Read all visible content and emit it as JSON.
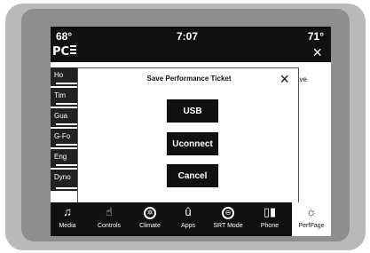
{
  "status": {
    "temp_left": "68°",
    "time": "7:07",
    "temp_right": "71°"
  },
  "app": {
    "logo": "PC",
    "close_icon": "×",
    "menu": [
      "Ho",
      "Tim",
      "Gua",
      "G-Fo",
      "Eng",
      "Dyno"
    ],
    "side_note": "ave"
  },
  "modal": {
    "title": "Save Performance Ticket",
    "close_icon": "×",
    "buttons": {
      "usb": "USB",
      "uconnect": "Uconnect",
      "cancel": "Cancel"
    }
  },
  "dock": {
    "active": "perfpage",
    "items": [
      {
        "label": "Media",
        "icon": "music-note-icon"
      },
      {
        "label": "Controls",
        "icon": "hand-controls-icon"
      },
      {
        "label": "Climate",
        "icon": "fan-icon"
      },
      {
        "label": "Apps",
        "icon": "apps-icon"
      },
      {
        "label": "SRT Mode",
        "icon": "steering-wheel-icon"
      },
      {
        "label": "Phone",
        "icon": "phone-signal-icon"
      },
      {
        "label": "PerfPage",
        "icon": "gauge-icon"
      }
    ]
  },
  "colors": {
    "background": "#ffffff",
    "screen": "#111111",
    "bezel": "#b9b9b9",
    "accent": "#111111"
  }
}
